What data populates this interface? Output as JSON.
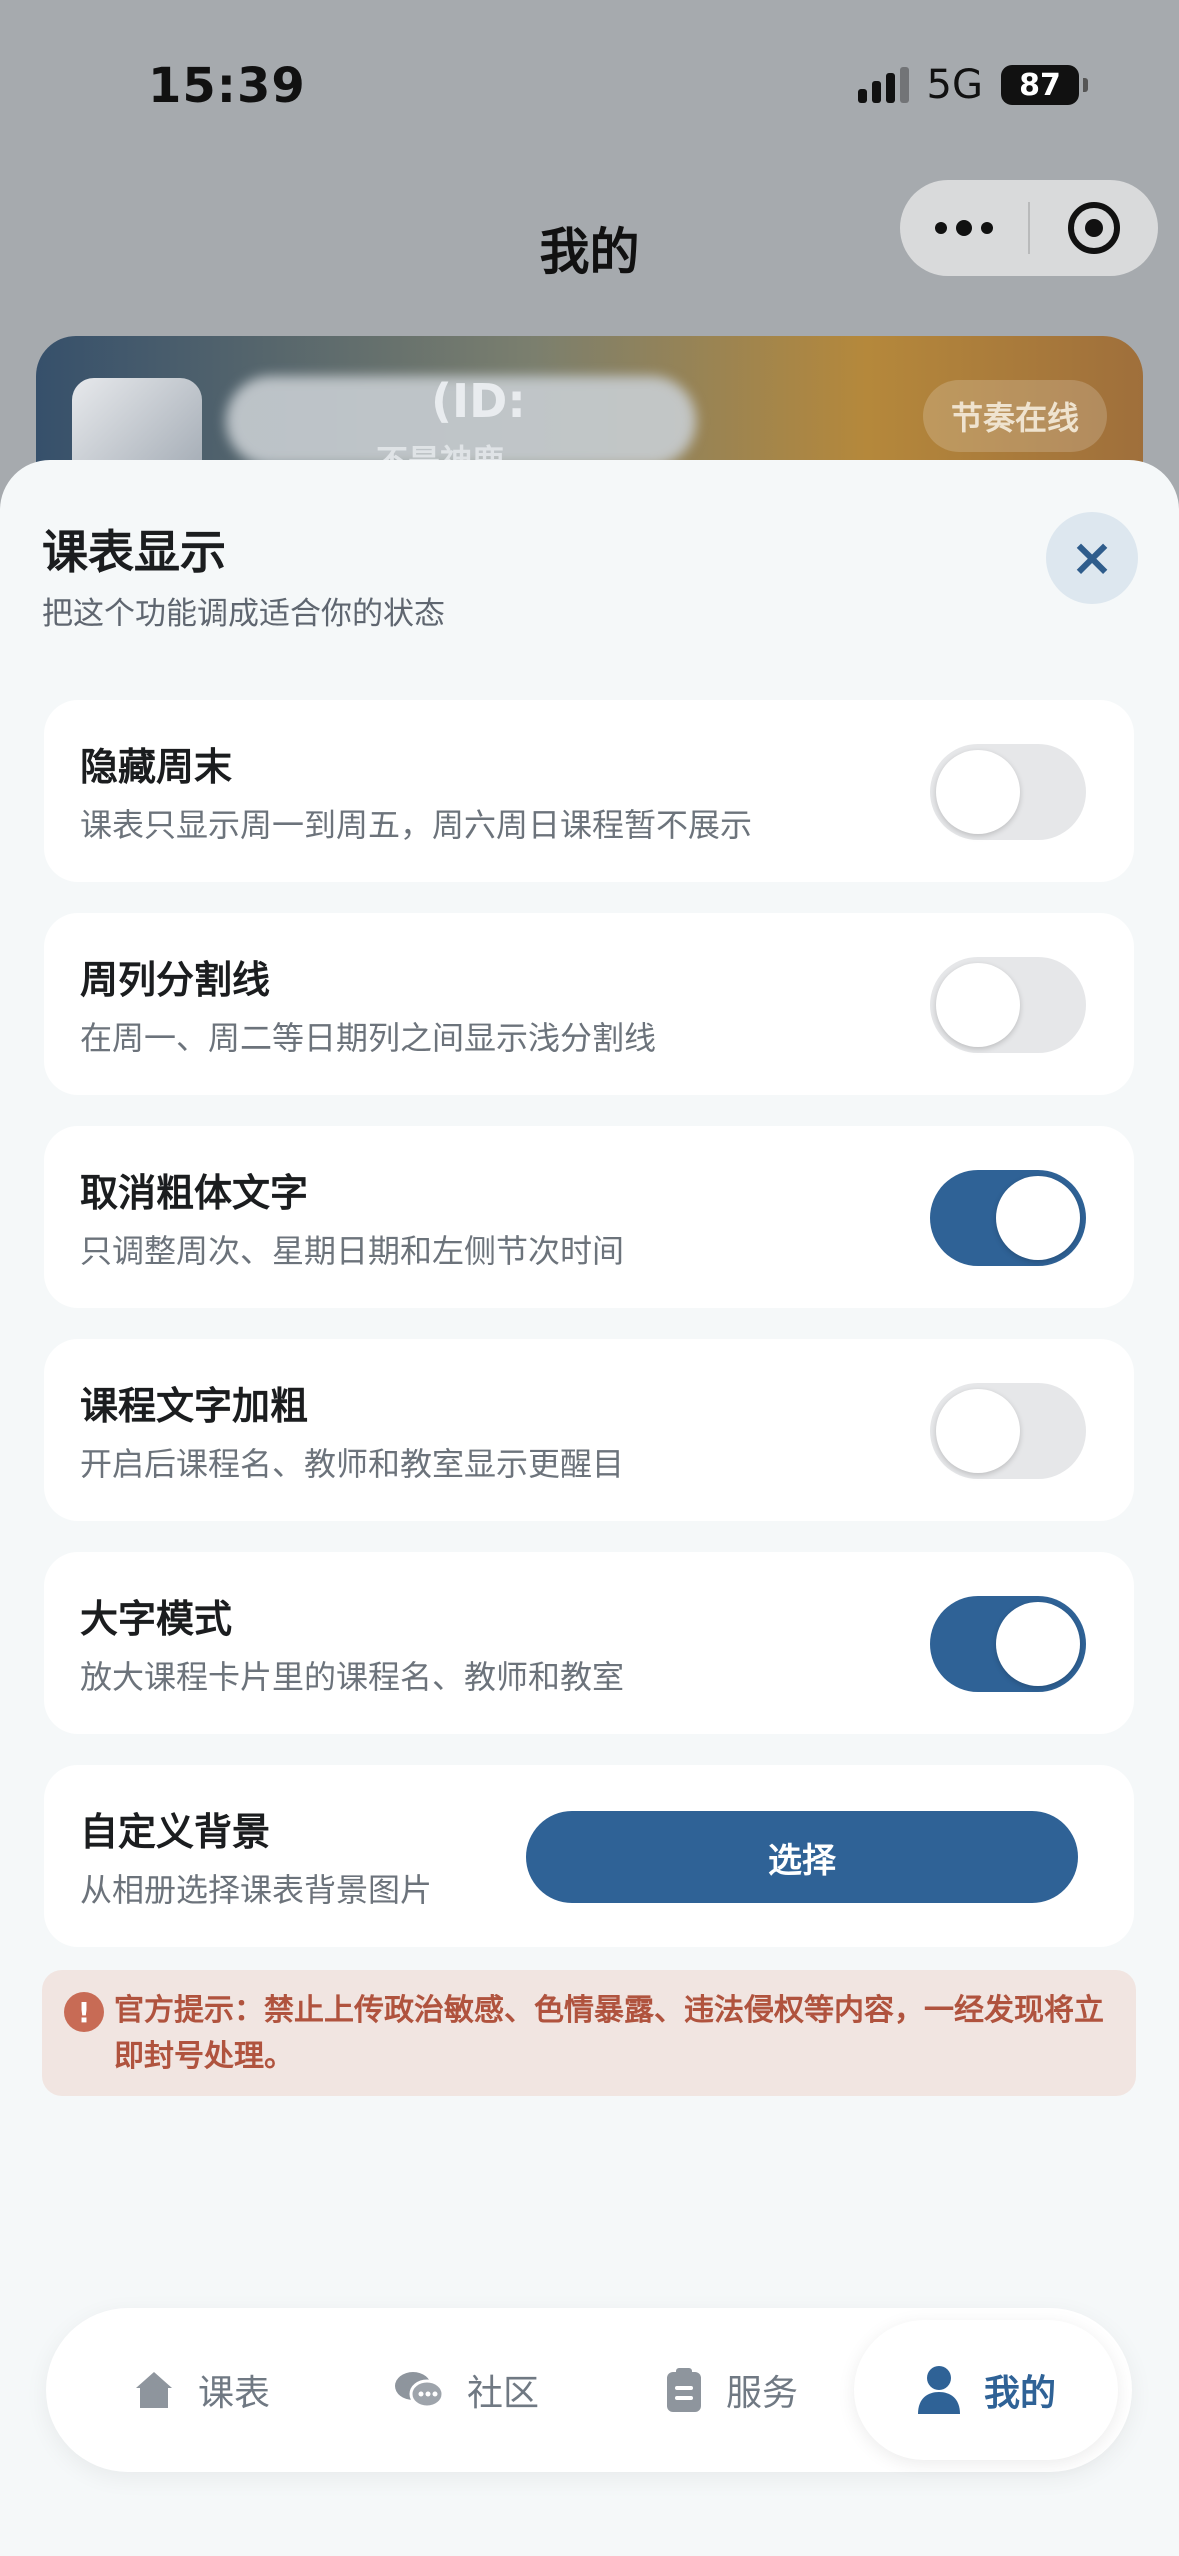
{
  "status_bar": {
    "time": "15:39",
    "network": "5G",
    "battery": "87"
  },
  "nav": {
    "title": "我的"
  },
  "profile": {
    "id_label": "(ID:",
    "subtitle_partial": "不是神鹿",
    "tag": "节奏在线"
  },
  "sheet": {
    "title": "课表显示",
    "subtitle": "把这个功能调成适合你的状态",
    "close_label": "×",
    "options": [
      {
        "title": "隐藏周末",
        "desc": "课表只显示周一到周五，周六周日课程暂不展示",
        "enabled": false
      },
      {
        "title": "周列分割线",
        "desc": "在周一、周二等日期列之间显示浅分割线",
        "enabled": false
      },
      {
        "title": "取消粗体文字",
        "desc": "只调整周次、星期日期和左侧节次时间",
        "enabled": true
      },
      {
        "title": "课程文字加粗",
        "desc": "开启后课程名、教师和教室显示更醒目",
        "enabled": false
      },
      {
        "title": "大字模式",
        "desc": "放大课程卡片里的课程名、教师和教室",
        "enabled": true
      }
    ],
    "background": {
      "title": "自定义背景",
      "desc": "从相册选择课表背景图片",
      "button": "选择"
    },
    "notice": {
      "icon": "!",
      "text": "官方提示：禁止上传政治敏感、色情暴露、违法侵权等内容，一经发现将立即封号处理。"
    }
  },
  "tabbar": {
    "items": [
      {
        "label": "课表",
        "icon": "home-icon",
        "active": false
      },
      {
        "label": "社区",
        "icon": "chat-bubbles-icon",
        "active": false
      },
      {
        "label": "服务",
        "icon": "clipboard-icon",
        "active": false
      },
      {
        "label": "我的",
        "icon": "user-icon",
        "active": true
      }
    ]
  },
  "colors": {
    "accent": "#2f6296",
    "toggle_off": "#e6e7e9",
    "notice_text": "#b0533e",
    "notice_bg": "#f1e5e1"
  }
}
